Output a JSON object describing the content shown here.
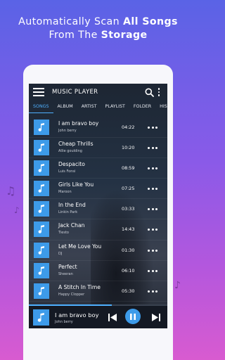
{
  "headline": {
    "line1_prefix": "Automatically Scan ",
    "line1_bold": "All Songs",
    "line2_prefix": "From The ",
    "line2_bold": "Storage"
  },
  "app": {
    "title": "MUSIC PLAYER",
    "icons": {
      "menu": "menu-icon",
      "search": "search-icon",
      "more": "more-vertical-icon"
    }
  },
  "tabs": [
    {
      "label": "SONGS",
      "active": true
    },
    {
      "label": "ALBUM",
      "active": false
    },
    {
      "label": "ARTIST",
      "active": false
    },
    {
      "label": "PLAYLIST",
      "active": false
    },
    {
      "label": "FOLDER",
      "active": false
    },
    {
      "label": "HIS",
      "active": false
    }
  ],
  "songs": [
    {
      "title": "I am bravo boy",
      "artist": "John berry",
      "duration": "04:22"
    },
    {
      "title": "Cheap Thrills",
      "artist": "Allie goulding",
      "duration": "10:20"
    },
    {
      "title": "Despacito",
      "artist": "Luis Fonsi",
      "duration": "08:59"
    },
    {
      "title": "Girls Like You",
      "artist": "Maroon",
      "duration": "07:25"
    },
    {
      "title": "In the End",
      "artist": "Linkin Park",
      "duration": "03:33"
    },
    {
      "title": "Jack Chan",
      "artist": "Tiesto",
      "duration": "14:43"
    },
    {
      "title": "Let Me Love You",
      "artist": "DJ",
      "duration": "01:30"
    },
    {
      "title": "Perfect",
      "artist": "Sheeran",
      "duration": "06:10"
    },
    {
      "title": "A Stitch In Time",
      "artist": "Happy Clopper",
      "duration": "05:30"
    }
  ],
  "now_playing": {
    "title": "I am bravo boy",
    "artist": "John berry",
    "progress": 0.6
  },
  "colors": {
    "accent": "#3d9be9",
    "active_tab": "#4fb0ff"
  }
}
